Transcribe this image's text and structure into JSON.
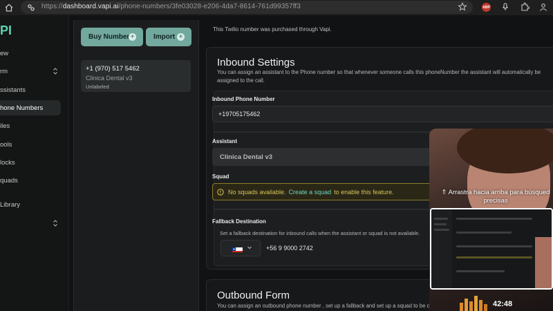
{
  "browser": {
    "url_prefix": "https://",
    "url_host": "dashboard.vapi.ai",
    "url_path": "/phone-numbers/3fe03028-e206-4da7-8614-761d99357ff3",
    "extension_abp": "ABP"
  },
  "sidebar": {
    "logo": "PI",
    "items": [
      {
        "label": "ew"
      },
      {
        "label": "rm"
      },
      {
        "label": "ssistants"
      },
      {
        "label": "hone Numbers"
      },
      {
        "label": "iles"
      },
      {
        "label": "ools"
      },
      {
        "label": "locks"
      },
      {
        "label": "quads"
      },
      {
        "label": "Library"
      }
    ]
  },
  "numbers_list": {
    "buy_label": "Buy Number",
    "import_label": "Import",
    "items": [
      {
        "number": "+1 (970) 517 5462",
        "assistant": "Clinica Dental v3",
        "label": "Unlabeled"
      }
    ]
  },
  "main": {
    "purchased_note": "This Twilio number was purchased through Vapi.",
    "inbound": {
      "title": "Inbound Settings",
      "description": "You can assign an assistant to the Phone number so that whenever someone calls this phoneNumber the assistant will automatically be assigned to the call.",
      "phone_label": "Inbound Phone Number",
      "phone_value": "+19705175462",
      "assistant_label": "Assistant",
      "assistant_value": "Clinica Dental v3",
      "squad_label": "Squad",
      "squad_warning_pre": "No squads available.",
      "squad_warning_link": "Create a squad",
      "squad_warning_post": "to enable this feature.",
      "fallback_label": "Fallback Destination",
      "fallback_desc": "Set a fallback destination for inbound calls when the assistant or squad is not available.",
      "fallback_value": "+56 9 9000 2742"
    },
    "outbound": {
      "title": "Outbound Form",
      "description": "You can assign an outbound phone number , set up a fallback and set up a squad to be ca"
    }
  },
  "video": {
    "caption": "Arrastra hacia arriba para búsqued precisas",
    "timestamp": "42:48"
  },
  "colors": {
    "accent": "#72a89e",
    "warning": "#d8c45a",
    "link": "#6fd6c4"
  }
}
